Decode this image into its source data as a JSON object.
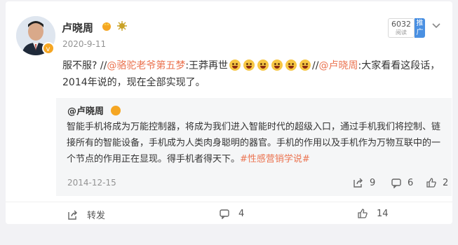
{
  "author": {
    "name": "卢晓周",
    "avatar_icon": "user-avatar-photo"
  },
  "post": {
    "date": "2020-9-11",
    "text_start": "服不服? //",
    "mention1": "@骆驼老爷第五梦",
    "text_mid": ":王莽再世",
    "text_sep": "//",
    "mention2": "@卢晓周",
    "text_end": ":大家看看这段话，2014年说的，现在全部实现了。"
  },
  "reads": {
    "count": "6032",
    "label": "阅读",
    "promote_label": "推广"
  },
  "repost": {
    "author": "@卢晓周",
    "text": "智能手机将成为万能控制器，将成为我们进入智能时代的超级入口，通过手机我们将控制、链接所有的智能设备，手机成为人类肉身聪明的器官。手机的作用以及手机作为万物互联中的一个节点的作用正在显现。得手机者得天下。",
    "hashtag": "#性感营销学说#",
    "date": "2014-12-15",
    "forwards": "9",
    "comments": "6",
    "likes": "2"
  },
  "actions": {
    "forward_label": "转发",
    "comments_count": "4",
    "likes_count": "14"
  },
  "colors": {
    "link": "#eb7350",
    "promote": "#4a90e2",
    "verify": "#f5a623"
  }
}
